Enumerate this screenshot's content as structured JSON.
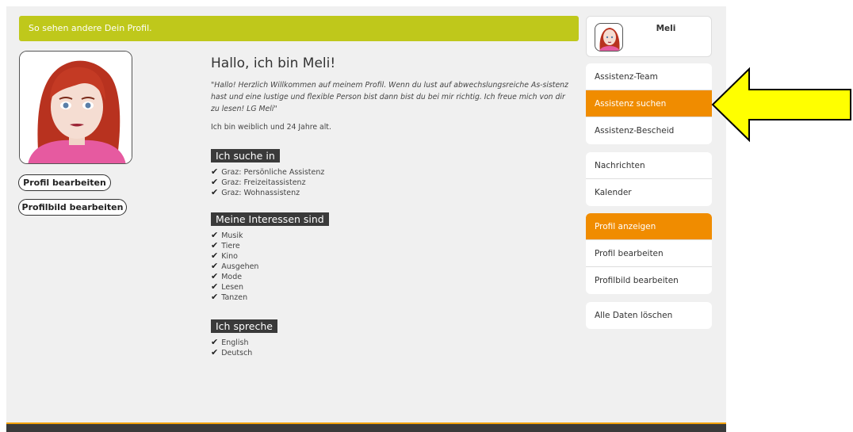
{
  "banner": {
    "text": "So sehen andere Dein Profil."
  },
  "profile_buttons": {
    "edit": "Profil bearbeiten",
    "edit_picture": "Profilbild bearbeiten"
  },
  "main": {
    "title": "Hallo, ich bin Meli!",
    "quote": "\"Hallo! Herzlich Willkommen auf meinem Profil. Wenn du lust auf abwechslungsreiche As-sistenz hast und eine lustige und flexible Person bist dann bist du bei mir richtig. Ich freue mich von dir zu lesen! LG Meli\"",
    "age_text": "Ich bin weiblich und 24 Jahre alt.",
    "search": {
      "heading": "Ich suche in",
      "items": [
        "Graz: Persönliche Assistenz",
        "Graz: Freizeitassistenz",
        "Graz: Wohnassistenz"
      ]
    },
    "interests": {
      "heading": "Meine Interessen sind",
      "items": [
        "Musik",
        "Tiere",
        "Kino",
        "Ausgehen",
        "Mode",
        "Lesen",
        "Tanzen"
      ]
    },
    "languages": {
      "heading": "Ich spreche",
      "items": [
        "English",
        "Deutsch"
      ]
    }
  },
  "sidebar": {
    "user_name": "Meli",
    "group1": [
      "Assistenz-Team",
      "Assistenz suchen",
      "Assistenz-Bescheid"
    ],
    "group2": [
      "Nachrichten",
      "Kalender"
    ],
    "group3": [
      "Profil anzeigen",
      "Profil bearbeiten",
      "Profilbild bearbeiten"
    ],
    "group4": [
      "Alle Daten löschen"
    ]
  },
  "colors": {
    "banner": "#bfc81b",
    "accent": "#f08c00",
    "arrow": "#ffff00",
    "heading_bg": "#3a3a3a"
  }
}
